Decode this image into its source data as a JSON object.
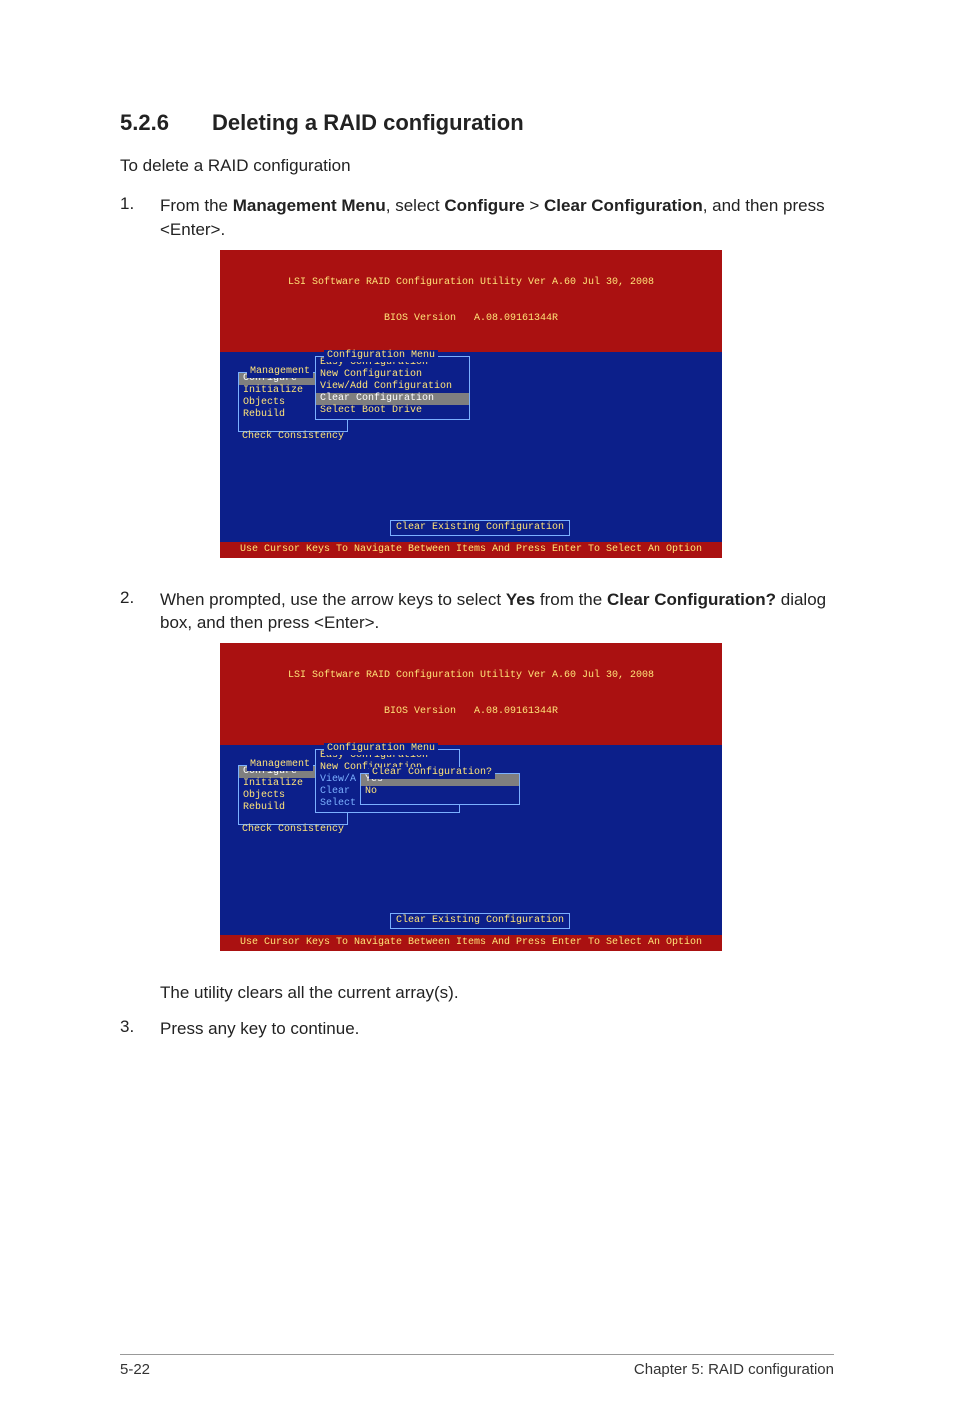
{
  "heading": {
    "number": "5.2.6",
    "title": "Deleting a RAID configuration"
  },
  "intro": "To delete a RAID configuration",
  "steps": [
    {
      "n": "1.",
      "pre": "From the ",
      "b1": "Management Menu",
      "mid1": ", select ",
      "b2": "Configure",
      "mid2": " > ",
      "b3": "Clear Configuration",
      "post": ", and then press <Enter>."
    },
    {
      "n": "2.",
      "pre": "When prompted, use the arrow keys to select ",
      "b1": "Yes",
      "mid1": " from the ",
      "b2": "Clear Configuration?",
      "post": " dialog box, and then press <Enter>."
    },
    {
      "n": "",
      "plain": "The utility clears all the current array(s)."
    },
    {
      "n": "3.",
      "plain": "Press any key to continue."
    }
  ],
  "bios": {
    "header1": "LSI Software RAID Configuration Utility Ver A.60 Jul 30, 2008",
    "header2": "BIOS Version   A.08.09161344R",
    "footer": "Use Cursor Keys To Navigate Between Items And Press Enter To Select An Option",
    "status": "Clear Existing Configuration",
    "managementLabel": "Management",
    "configMenuLabel": "Configuration Menu",
    "clearConfigLabel": "Clear Configuration?",
    "managementItems": [
      "Configure",
      "Initialize",
      "Objects",
      "Rebuild",
      "Check Consistency"
    ],
    "configItems": [
      "Easy Configuration",
      "New Configuration",
      "View/Add Configuration",
      "Clear Configuration",
      "Select Boot Drive"
    ],
    "configItemsTrunc": [
      "Easy Configuration",
      "New Configuration",
      "View/A",
      "Clear",
      "Select"
    ],
    "dialogItems": [
      "Yes",
      "No"
    ]
  },
  "pageFooter": {
    "left": "5-22",
    "right": "Chapter 5: RAID configuration"
  }
}
